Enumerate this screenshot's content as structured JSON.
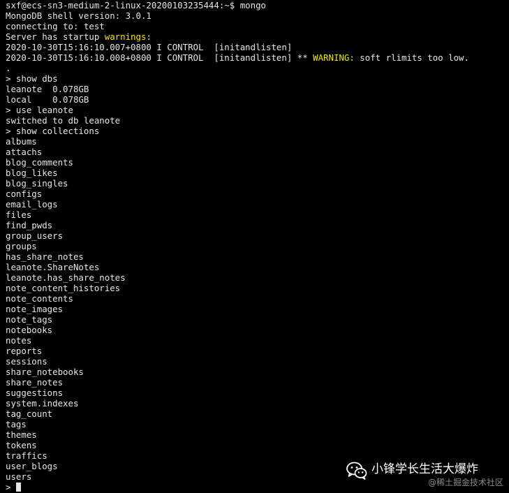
{
  "terminal": {
    "prompt_line": "sxf@ecs-sn3-medium-2-linux-20200103235444:~$ mongo",
    "shell_version": "MongoDB shell version: 3.0.1",
    "connecting": "connecting to: test",
    "startup_prefix": "Server has startup ",
    "startup_warn_word": "warnings",
    "startup_suffix": ":",
    "log1": "2020-10-30T15:16:10.007+0800 I CONTROL  [initandlisten]",
    "log2_prefix": "2020-10-30T15:16:10.008+0800 I CONTROL  [initandlisten] ** ",
    "log2_warn_word": "WARNING:",
    "log2_suffix": " soft rlimits too low.",
    "dot_line": ".",
    "cmd_show_dbs": "> show dbs",
    "dbs": [
      "leanote  0.078GB",
      "local    0.078GB"
    ],
    "cmd_use": "> use leanote",
    "switched": "switched to db leanote",
    "cmd_show_collections": "> show collections",
    "collections": [
      "albums",
      "attachs",
      "blog_comments",
      "blog_likes",
      "blog_singles",
      "configs",
      "email_logs",
      "files",
      "find_pwds",
      "group_users",
      "groups",
      "has_share_notes",
      "leanote.ShareNotes",
      "leanote.has_share_notes",
      "note_content_histories",
      "note_contents",
      "note_images",
      "note_tags",
      "notebooks",
      "notes",
      "reports",
      "sessions",
      "share_notebooks",
      "share_notes",
      "suggestions",
      "system.indexes",
      "tag_count",
      "tags",
      "themes",
      "tokens",
      "traffics",
      "user_blogs",
      "users"
    ],
    "input_prompt": "> "
  },
  "watermark": {
    "icon": "wechat-icon",
    "account": "小锋学长生活大爆炸",
    "site": "@稀土掘金技术社区"
  },
  "colors": {
    "background": "#000000",
    "text": "#e6e6e6",
    "warning": "#f3e21a"
  }
}
